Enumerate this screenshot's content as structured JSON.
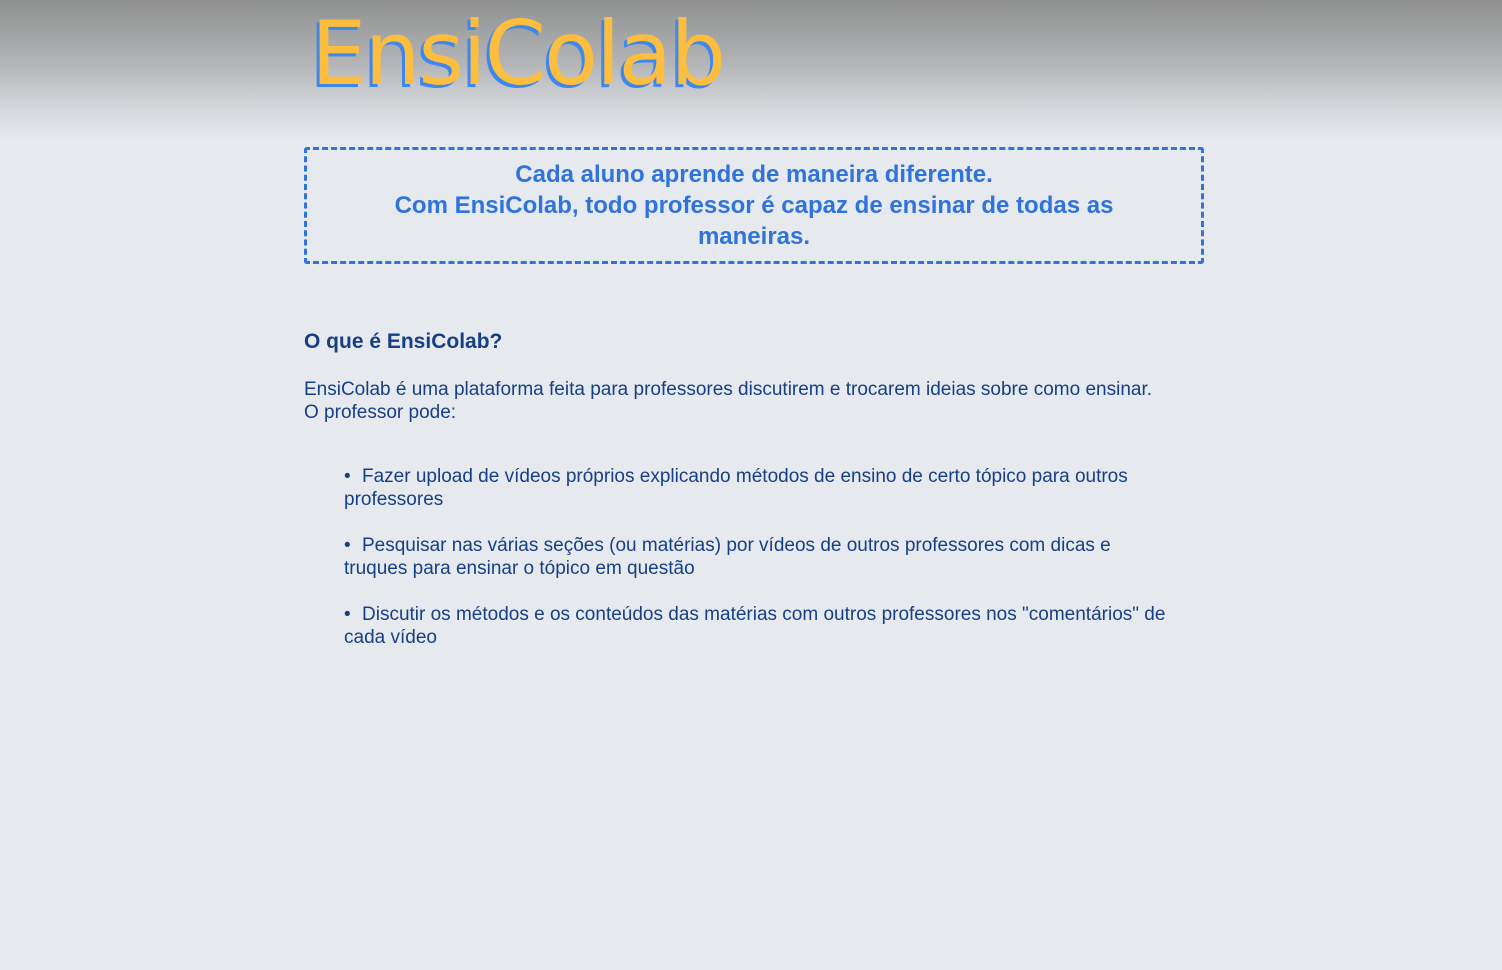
{
  "header": {
    "logo_text": "EnsiColab"
  },
  "tagline": {
    "line1": "Cada aluno aprende de maneira diferente.",
    "line2": "Com EnsiColab, todo professor é capaz de ensinar de todas as maneiras."
  },
  "about": {
    "title": "O que é EnsiColab?",
    "intro_line1": "EnsiColab é uma plataforma feita para professores discutirem e trocarem ideias sobre como ensinar.",
    "intro_line2": "O professor pode:",
    "features": [
      "Fazer upload de vídeos próprios explicando métodos de ensino de certo tópico para outros professores",
      "Pesquisar nas várias seções (ou matérias) por vídeos de outros professores com dicas e truques para ensinar o tópico em questão",
      "Discutir os métodos e os conteúdos das matérias com outros professores nos \"comentários\" de cada vídeo"
    ]
  },
  "colors": {
    "background": "#e6eaef",
    "logo_primary": "#fdbe3f",
    "logo_shadow": "#3c87f0",
    "accent_blue": "#2f73db",
    "text_dark_blue": "#163f85"
  }
}
